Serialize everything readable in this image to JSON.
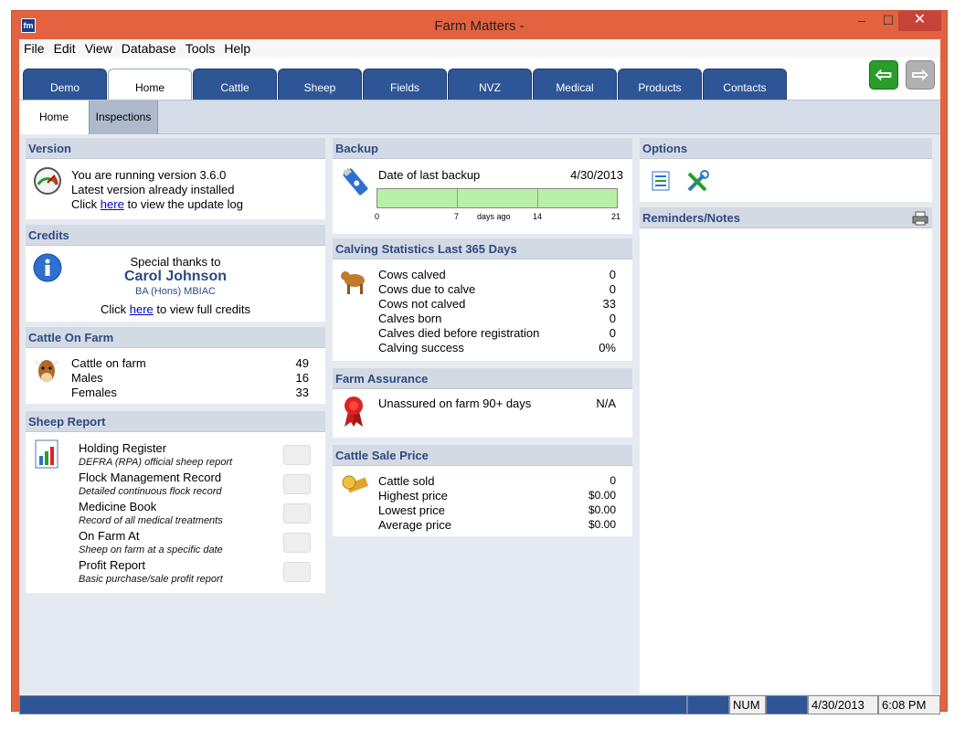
{
  "window": {
    "title": "Farm Matters -",
    "app_icon": "fm",
    "min": "–",
    "max": "☐",
    "close": "✕"
  },
  "menu": [
    "File",
    "Edit",
    "View",
    "Database",
    "Tools",
    "Help"
  ],
  "tabs": [
    "Demo",
    "Home",
    "Cattle",
    "Sheep",
    "Fields",
    "NVZ",
    "Medical",
    "Products",
    "Contacts"
  ],
  "subtabs": [
    "Home",
    "Inspections"
  ],
  "nav": {
    "back": "⇦",
    "forward": "⇨"
  },
  "version": {
    "header": "Version",
    "line1": "You are running version 3.6.0",
    "line2": "Latest version already installed",
    "line3_pre": "Click",
    "line3_link": "here",
    "line3_post": "to view the update log"
  },
  "credits": {
    "header": "Credits",
    "thanks": "Special thanks to",
    "name": "Carol Johnson",
    "quals": "BA (Hons) MBIAC",
    "click_pre": "Click",
    "click_link": "here",
    "click_post": "to view full credits"
  },
  "cattle_on_farm": {
    "header": "Cattle On Farm",
    "rows": [
      {
        "label": "Cattle on farm",
        "value": "49"
      },
      {
        "label": "Males",
        "value": "16"
      },
      {
        "label": "Females",
        "value": "33"
      }
    ]
  },
  "sheep_report": {
    "header": "Sheep Report",
    "items": [
      {
        "title": "Holding Register",
        "desc": "DEFRA (RPA) official sheep report"
      },
      {
        "title": "Flock Management Record",
        "desc": "Detailed continuous flock record"
      },
      {
        "title": "Medicine Book",
        "desc": "Record of all medical treatments"
      },
      {
        "title": "On Farm At",
        "desc": "Sheep on farm at a specific date"
      },
      {
        "title": "Profit Report",
        "desc": "Basic purchase/sale profit report"
      }
    ]
  },
  "backup": {
    "header": "Backup",
    "label": "Date of last backup",
    "date": "4/30/2013",
    "ticks": [
      "0",
      "7",
      "14",
      "21"
    ],
    "axis_label": "days ago",
    "max_days": 21
  },
  "calving": {
    "header": "Calving Statistics Last 365 Days",
    "rows": [
      {
        "label": "Cows calved",
        "value": "0"
      },
      {
        "label": "Cows due to calve",
        "value": "0"
      },
      {
        "label": "Cows not calved",
        "value": "33"
      },
      {
        "label": "Calves born",
        "value": "0"
      },
      {
        "label": "Calves died before registration",
        "value": "0"
      },
      {
        "label": "Calving success",
        "value": "0%"
      }
    ]
  },
  "assurance": {
    "header": "Farm Assurance",
    "label": "Unassured on farm 90+ days",
    "value": "N/A"
  },
  "sale_price": {
    "header": "Cattle Sale Price",
    "rows": [
      {
        "label": "Cattle sold",
        "value": "0"
      },
      {
        "label": "Highest price",
        "value": "$0.00"
      },
      {
        "label": "Lowest price",
        "value": "$0.00"
      },
      {
        "label": "Average price",
        "value": "$0.00"
      }
    ]
  },
  "options": {
    "header": "Options"
  },
  "reminders": {
    "header": "Reminders/Notes"
  },
  "status": {
    "num": "NUM",
    "date": "4/30/2013",
    "time": "6:08 PM"
  },
  "colors": {
    "tab_blue": "#2e5596",
    "header_text": "#2c4a80",
    "accent_green": "#2a9d2a"
  }
}
